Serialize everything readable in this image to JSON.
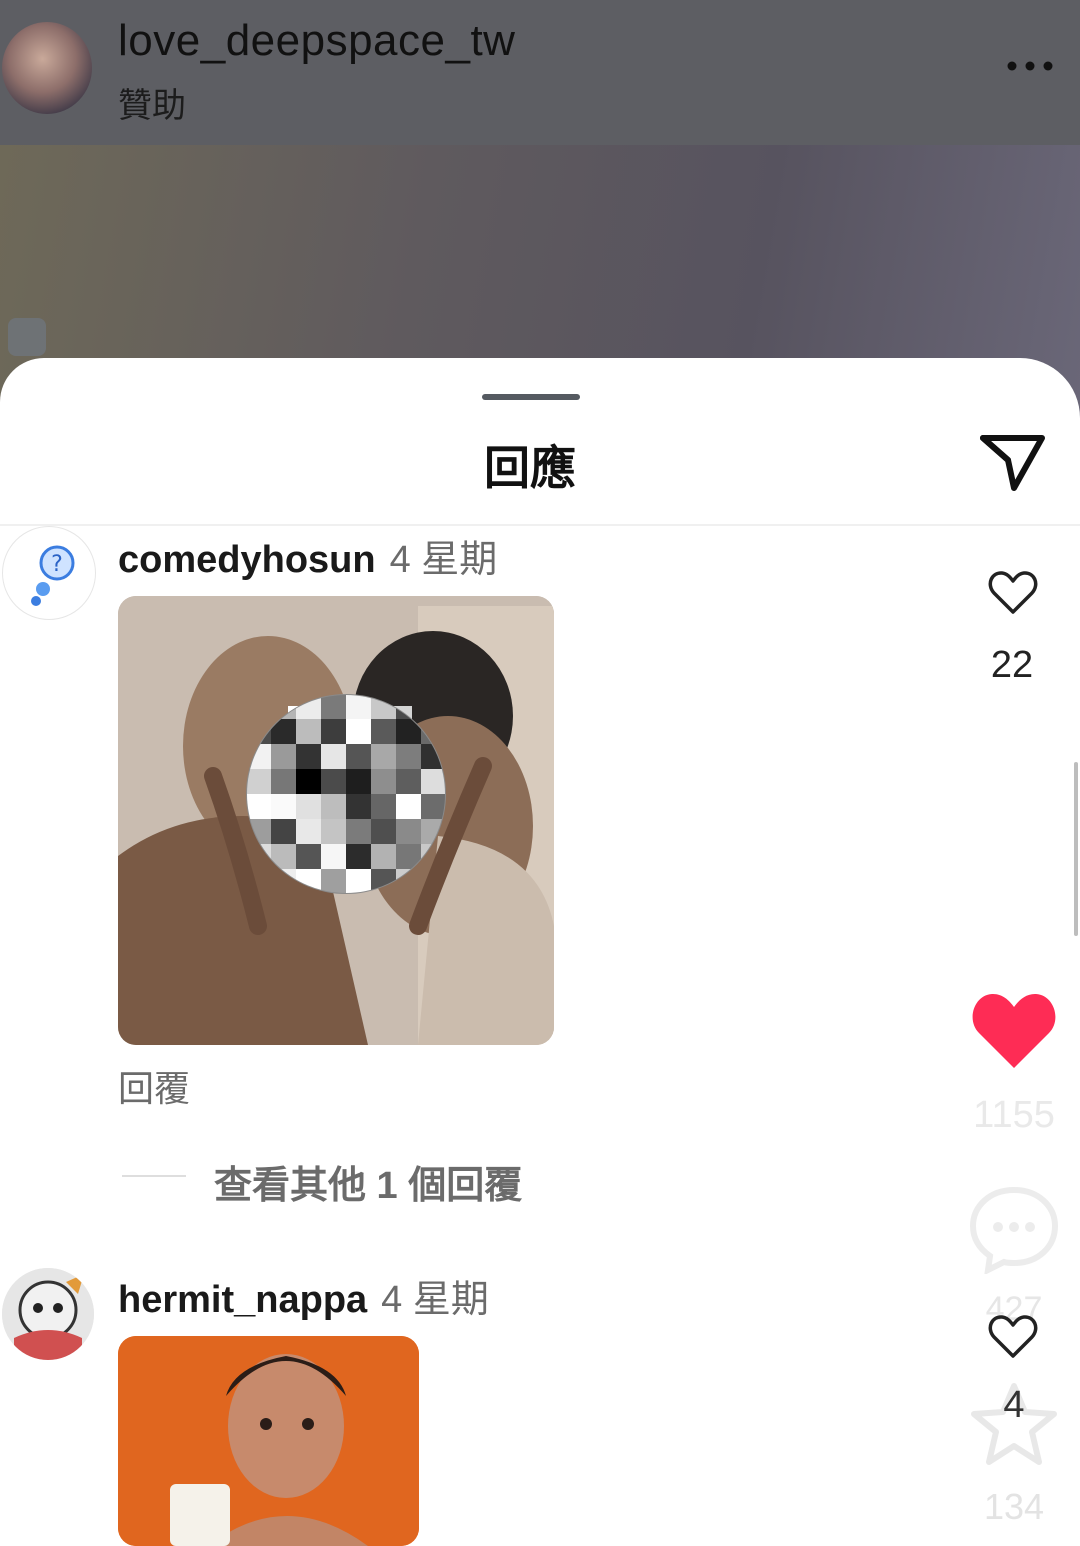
{
  "post": {
    "username": "love_deepspace_tw",
    "subtitle": "贊助"
  },
  "sheet": {
    "title": "回應"
  },
  "comments": [
    {
      "username": "comedyhosun",
      "time": "4 星期",
      "reply_label": "回覆",
      "view_more": "查看其他 1 個回覆",
      "like_count": "22"
    },
    {
      "username": "hermit_nappa",
      "time": "4 星期",
      "like_count": "4"
    }
  ],
  "overlay_actions": {
    "like_count": "1155",
    "comment_count": "427",
    "save_count": "134"
  },
  "colors": {
    "like_red": "#fe2c55",
    "header_bg": "#5d5e63"
  }
}
